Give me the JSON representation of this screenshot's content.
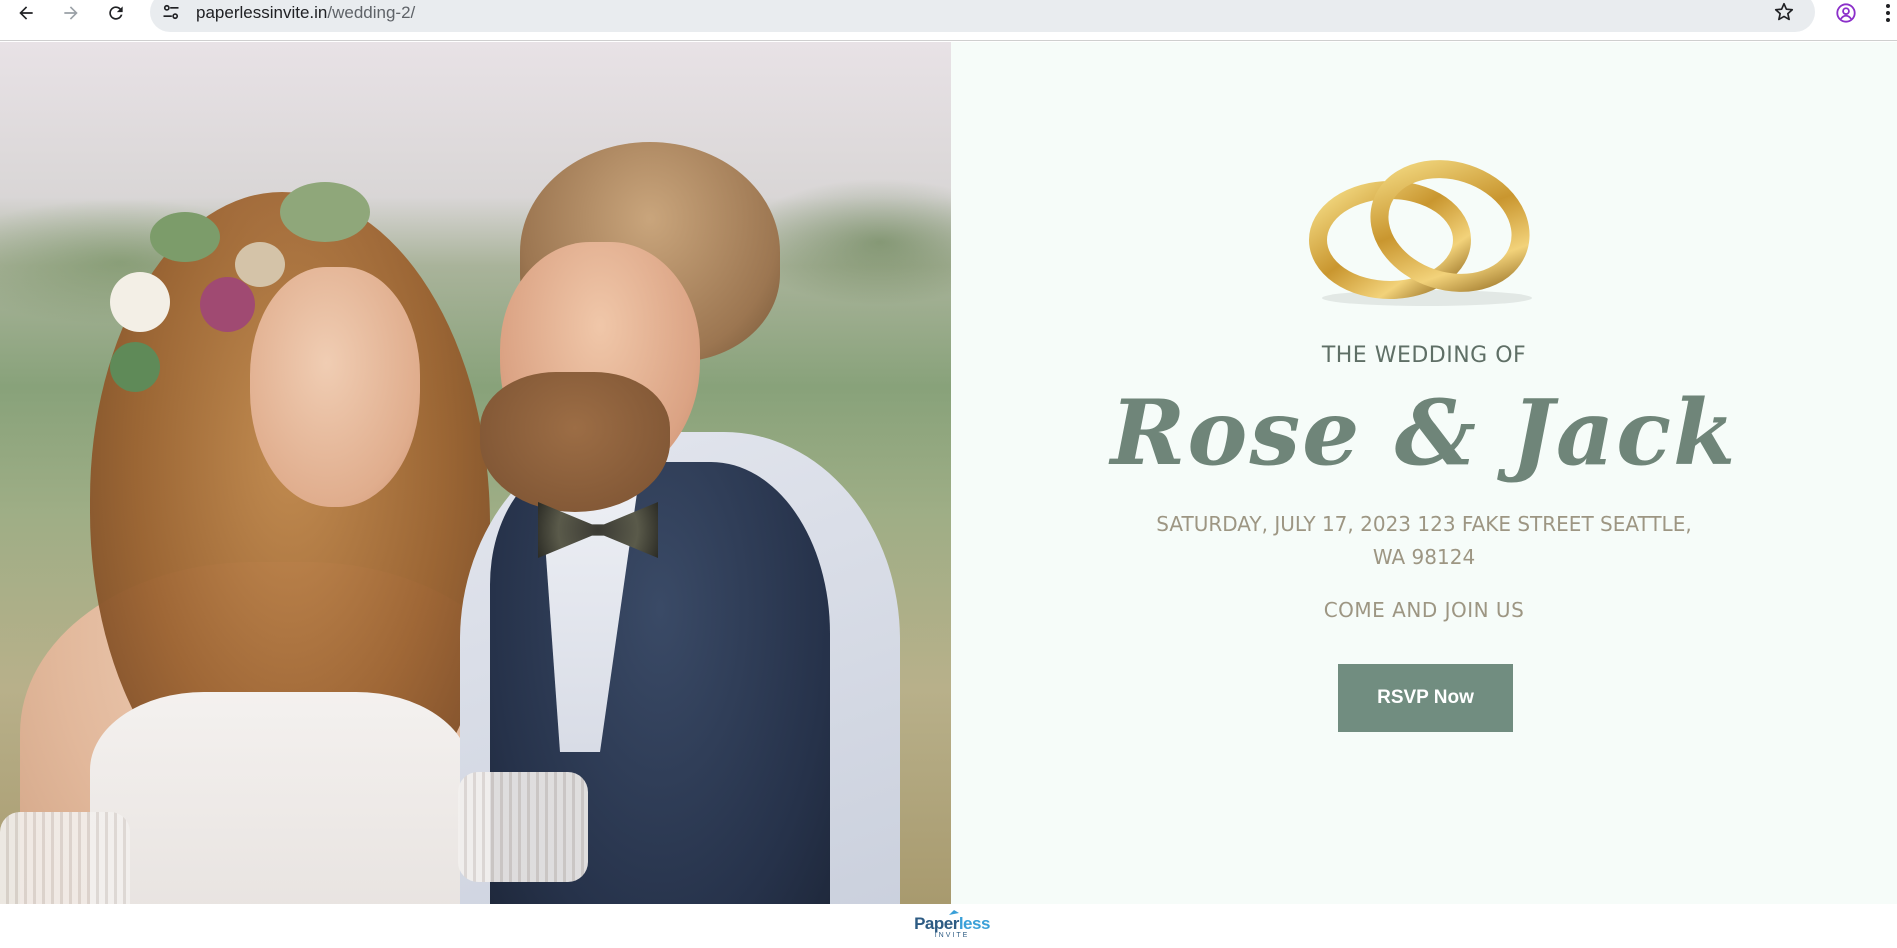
{
  "browser": {
    "url_host": "paperlessinvite.in",
    "url_path": "/wedding-2/",
    "icons": [
      "back-arrow-icon",
      "forward-arrow-icon",
      "reload-icon",
      "site-info-icon",
      "bookmark-star-icon",
      "profile-icon",
      "menu-kebab-icon"
    ]
  },
  "hero": {
    "photo_alt": "Bride with flower crown and groom with bow tie"
  },
  "invitation": {
    "eyebrow": "THE WEDDING OF",
    "names": "Rose & Jack",
    "details": "SATURDAY, JULY 17, 2023 123 FAKE STREET SEATTLE, WA 98124",
    "cta_text": "COME AND JOIN US",
    "rsvp_label": "RSVP Now",
    "colors": {
      "panel_bg": "#f6fcf9",
      "names": "#6f8579",
      "button": "#718d80",
      "detail_text": "#9d9683"
    }
  },
  "footer": {
    "logo_word_main": "Paper",
    "logo_word_accent": "less",
    "logo_sub": "INVITE"
  }
}
